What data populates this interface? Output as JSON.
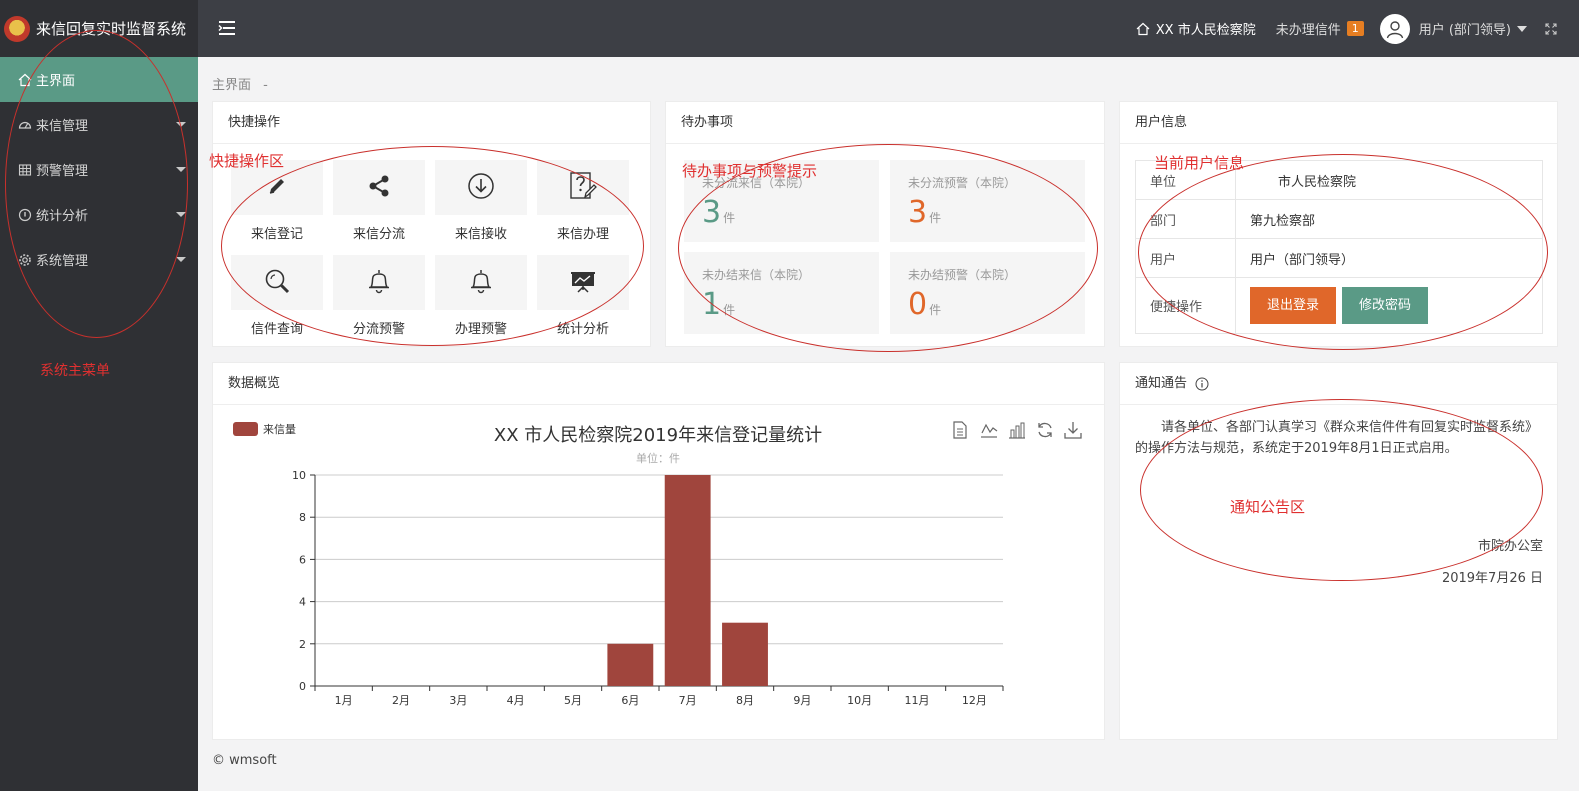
{
  "app": {
    "title": "来信回复实时监督系统"
  },
  "sidebar": {
    "items": [
      {
        "label": "主界面"
      },
      {
        "label": "来信管理"
      },
      {
        "label": "预警管理"
      },
      {
        "label": "统计分析"
      },
      {
        "label": "系统管理"
      }
    ],
    "annotation": "系统主菜单"
  },
  "topbar": {
    "org": "XX 市人民检察院",
    "unread_label": "未办理信件",
    "unread_count": "1",
    "user": "用户 (部门领导)"
  },
  "breadcrumb": {
    "text": "主界面",
    "sep": "-"
  },
  "quick": {
    "title": "快捷操作",
    "annotation": "快捷操作区",
    "items": [
      {
        "label": "来信登记",
        "icon": "pencil-icon"
      },
      {
        "label": "来信分流",
        "icon": "share-icon"
      },
      {
        "label": "来信接收",
        "icon": "download-circle-icon"
      },
      {
        "label": "来信办理",
        "icon": "question-edit-icon"
      },
      {
        "label": "信件查询",
        "icon": "magnifier-icon"
      },
      {
        "label": "分流预警",
        "icon": "bell-icon"
      },
      {
        "label": "办理预警",
        "icon": "bell-icon"
      },
      {
        "label": "统计分析",
        "icon": "presentation-chart-icon"
      }
    ]
  },
  "todo": {
    "title": "待办事项",
    "annotation": "待办事项与预警提示",
    "cells": [
      {
        "label": "未分流来信（本院）",
        "num": "3",
        "unit": "件"
      },
      {
        "label": "未分流预警（本院）",
        "num": "3",
        "unit": "件"
      },
      {
        "label": "未办结来信（本院）",
        "num": "1",
        "unit": "件"
      },
      {
        "label": "未办结预警（本院）",
        "num": "0",
        "unit": "件"
      }
    ]
  },
  "userinfo": {
    "title": "用户信息",
    "annotation": "当前用户信息",
    "rows": [
      {
        "k": "单位",
        "v": "市人民检察院"
      },
      {
        "k": "部门",
        "v": "第九检察部"
      },
      {
        "k": "用户",
        "v": "用户（部门领导）"
      }
    ],
    "ops_label": "便捷操作",
    "logout": "退出登录",
    "change_pwd": "修改密码"
  },
  "overview": {
    "title": "数据概览"
  },
  "chart_data": {
    "type": "bar",
    "title": "XX 市人民检察院2019年来信登记量统计",
    "subtitle": "单位：件",
    "legend": [
      "来信量"
    ],
    "categories": [
      "1月",
      "2月",
      "3月",
      "4月",
      "5月",
      "6月",
      "7月",
      "8月",
      "9月",
      "10月",
      "11月",
      "12月"
    ],
    "series": [
      {
        "name": "来信量",
        "values": [
          0,
          0,
          0,
          0,
          0,
          2,
          10,
          3,
          0,
          0,
          0,
          0
        ]
      }
    ],
    "ylim": [
      0,
      10
    ],
    "yticks": [
      0,
      2,
      4,
      6,
      8,
      10
    ],
    "grid": true,
    "legend_position": "top-left",
    "color": "#a0453d"
  },
  "notice": {
    "title": "通知通告",
    "annotation": "通知公告区",
    "text": "请各单位、各部门认真学习《群众来信件件有回复实时监督系统》的操作方法与规范，系统定于2019年8月1日正式启用。",
    "from": "市院办公室",
    "date": "2019年7月26 日"
  },
  "footer": {
    "text": "© wmsoft"
  }
}
